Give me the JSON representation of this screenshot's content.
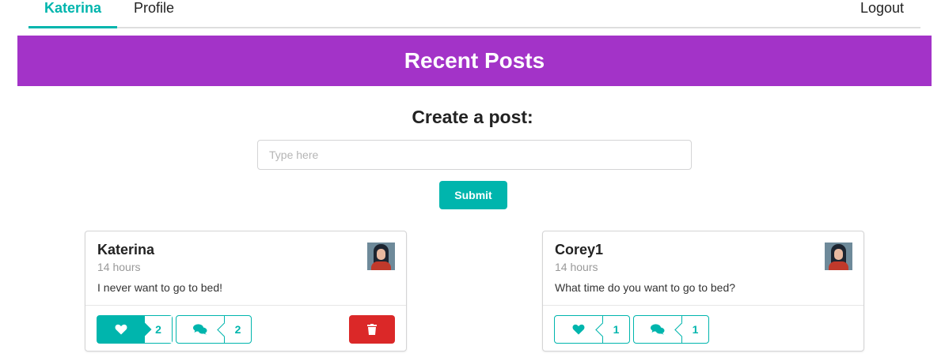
{
  "nav": {
    "home_label": "Katerina",
    "profile_label": "Profile",
    "logout_label": "Logout"
  },
  "banner": {
    "title": "Recent Posts"
  },
  "create": {
    "title": "Create a post:",
    "placeholder": "Type here",
    "value": "",
    "submit_label": "Submit"
  },
  "posts": [
    {
      "author": "Katerina",
      "time": "14 hours",
      "text": "I never want to go to bed!",
      "likes": "2",
      "comments": "2",
      "liked": true,
      "deletable": true
    },
    {
      "author": "Corey1",
      "time": "14 hours",
      "text": "What time do you want to go to bed?",
      "likes": "1",
      "comments": "1",
      "liked": false,
      "deletable": false
    }
  ],
  "icons": {
    "like": "heart-icon",
    "comment": "comments-icon",
    "delete": "trash-icon"
  },
  "colors": {
    "teal": "#00b5ad",
    "purple": "#a333c8",
    "red": "#db2828"
  }
}
